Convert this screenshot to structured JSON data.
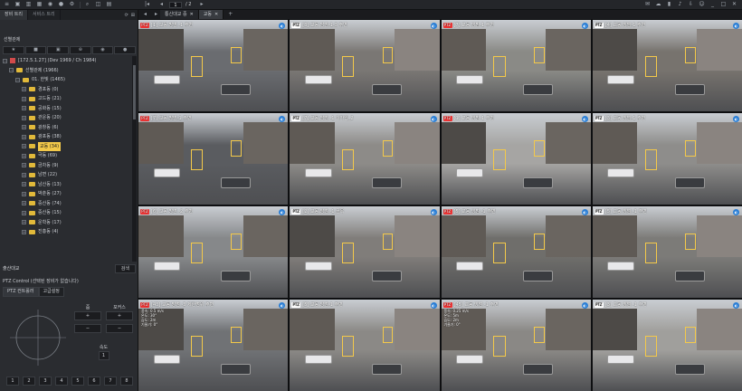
{
  "toolbar": {
    "icons": [
      "menu-icon",
      "monitor-icon",
      "layout-icon",
      "grid-icon",
      "camera-icon",
      "record-icon",
      "settings-icon",
      "search-icon",
      "map-icon",
      "layout2-icon",
      "user-icon",
      "chart-icon",
      "prev-icon"
    ],
    "page_current": "1",
    "page_total": "/ 2",
    "right_icons": [
      "chat-icon",
      "cloud-icon",
      "lock-icon",
      "alarm-icon",
      "download-icon",
      "user-icon",
      "minimize-icon",
      "maximize-icon",
      "close-icon"
    ]
  },
  "left_panel": {
    "tabs": [
      "장비 트리",
      "서비스 트리"
    ],
    "tree_title": "선별관제",
    "server": "[172.5.1.27] (Dev 1969 / Ch 1984)",
    "tree": [
      {
        "label": "선별관제 (1966)",
        "level": 1
      },
      {
        "label": "01. 한빛 (1465)",
        "level": 2
      },
      {
        "label": "경포동 (0)",
        "level": 3
      },
      {
        "label": "고드동 (21)",
        "level": 3
      },
      {
        "label": "공화동 (15)",
        "level": 3
      },
      {
        "label": "관운동 (20)",
        "level": 3
      },
      {
        "label": "광창동 (6)",
        "level": 3
      },
      {
        "label": "광포동 (38)",
        "level": 3
      },
      {
        "label": "교동 (34)",
        "level": 3,
        "selected": true
      },
      {
        "label": "극동 (69)",
        "level": 3
      },
      {
        "label": "금차동 (9)",
        "level": 3
      },
      {
        "label": "남면 (22)",
        "level": 3
      },
      {
        "label": "남산동 (13)",
        "level": 3
      },
      {
        "label": "박춘동 (27)",
        "level": 3
      },
      {
        "label": "중산동 (74)",
        "level": 3
      },
      {
        "label": "중산동 (15)",
        "level": 3
      },
      {
        "label": "운학동 (17)",
        "level": 3
      },
      {
        "label": "진흥동 (4)",
        "level": 3
      }
    ],
    "recording_label": "출산대교",
    "search_button": "검색",
    "ptz_title": "PTZ Control (선택된 장비가 없습니다)",
    "ptz_tabs": [
      "PTZ 컨트롤러",
      "고급설정"
    ],
    "ptz_zoom_label": "줌",
    "ptz_focus_label": "포커스",
    "ptz_speed_label": "속도",
    "ptz_speed_value": "1",
    "presets": [
      "1",
      "2",
      "3",
      "4",
      "5",
      "6",
      "7",
      "8"
    ]
  },
  "main": {
    "tabs": [
      {
        "label": "통신대교 중",
        "active": false
      },
      {
        "label": "교동",
        "active": true
      }
    ],
    "cameras": [
      {
        "label": "[1] 교동 방범 -1 주변",
        "info": "",
        "bg": "#6a6c70"
      },
      {
        "label": "[3] 교동 방범-1-3 주변",
        "info": "",
        "bg": "#7a7774"
      },
      {
        "label": "[7] 교동 방범-1 주변",
        "info": "",
        "bg": "#8a8a86"
      },
      {
        "label": "[4] 교동 방범-1 주변",
        "info": "",
        "bg": "#77736e"
      },
      {
        "label": "[7] 교동 방범-1 주변",
        "info": "",
        "bg": "#5a5c60"
      },
      {
        "label": "[7] 교동 방범 -1 이가입_2",
        "info": "",
        "bg": "#8d8b88"
      },
      {
        "label": "[1] 교동 방범-1 주변",
        "info": "",
        "bg": "#a6a5a3"
      },
      {
        "label": "[3] 교동 방범-1 주변",
        "info": "",
        "bg": "#8e8d8b"
      },
      {
        "label": "[6] 교동 방범 -2 주변",
        "info": "",
        "bg": "#86888a"
      },
      {
        "label": "[2] 교동 방범 -1 골목",
        "info": "",
        "bg": "#807d7a"
      },
      {
        "label": "[5] 교동 방범 -1 주변",
        "info": "",
        "bg": "#6f6e6b"
      },
      {
        "label": "[5] 교동 방범 -1 주변",
        "info": "",
        "bg": "#7c7b78"
      },
      {
        "label": "[43] 교동 방범 -3 제한범위 주변",
        "info": "풍속: 0.5 m/s\n온도: 30°\n습도: 2m\n기울기: 0°",
        "bg": "#707275"
      },
      {
        "label": "[5] 교동 방범-1 주변",
        "info": "",
        "bg": "#8b8986"
      },
      {
        "label": "[45] 교동 방범 -1 주변",
        "info": "풍속: 0.25 m/s\n온도: 5m\n습도: 2m\n기울기: 0°",
        "bg": "#8a8885"
      },
      {
        "label": "[3] 교동 방범 -1 주변",
        "info": "",
        "bg": "#a09f9c"
      }
    ]
  }
}
